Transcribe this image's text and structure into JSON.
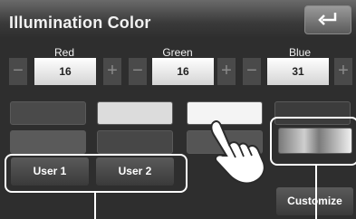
{
  "header": {
    "title": "Illumination Color"
  },
  "channels": [
    {
      "label": "Red",
      "value": "16"
    },
    {
      "label": "Green",
      "value": "16"
    },
    {
      "label": "Blue",
      "value": "31"
    }
  ],
  "controls": {
    "minus_glyph": "−",
    "plus_glyph": "+"
  },
  "presets": {
    "user1": "User 1",
    "user2": "User 2"
  },
  "customize_label": "Customize",
  "icons": {
    "back": "back-arrow-icon",
    "hand": "pointing-hand-icon"
  },
  "swatch_colors": [
    [
      "#4a4a4a",
      "#dcdcdc",
      "#f4f4f4",
      "#3c3c3c"
    ],
    [
      "#5a5a5a",
      "#474747",
      "#555555",
      "#c8c8c8"
    ]
  ]
}
